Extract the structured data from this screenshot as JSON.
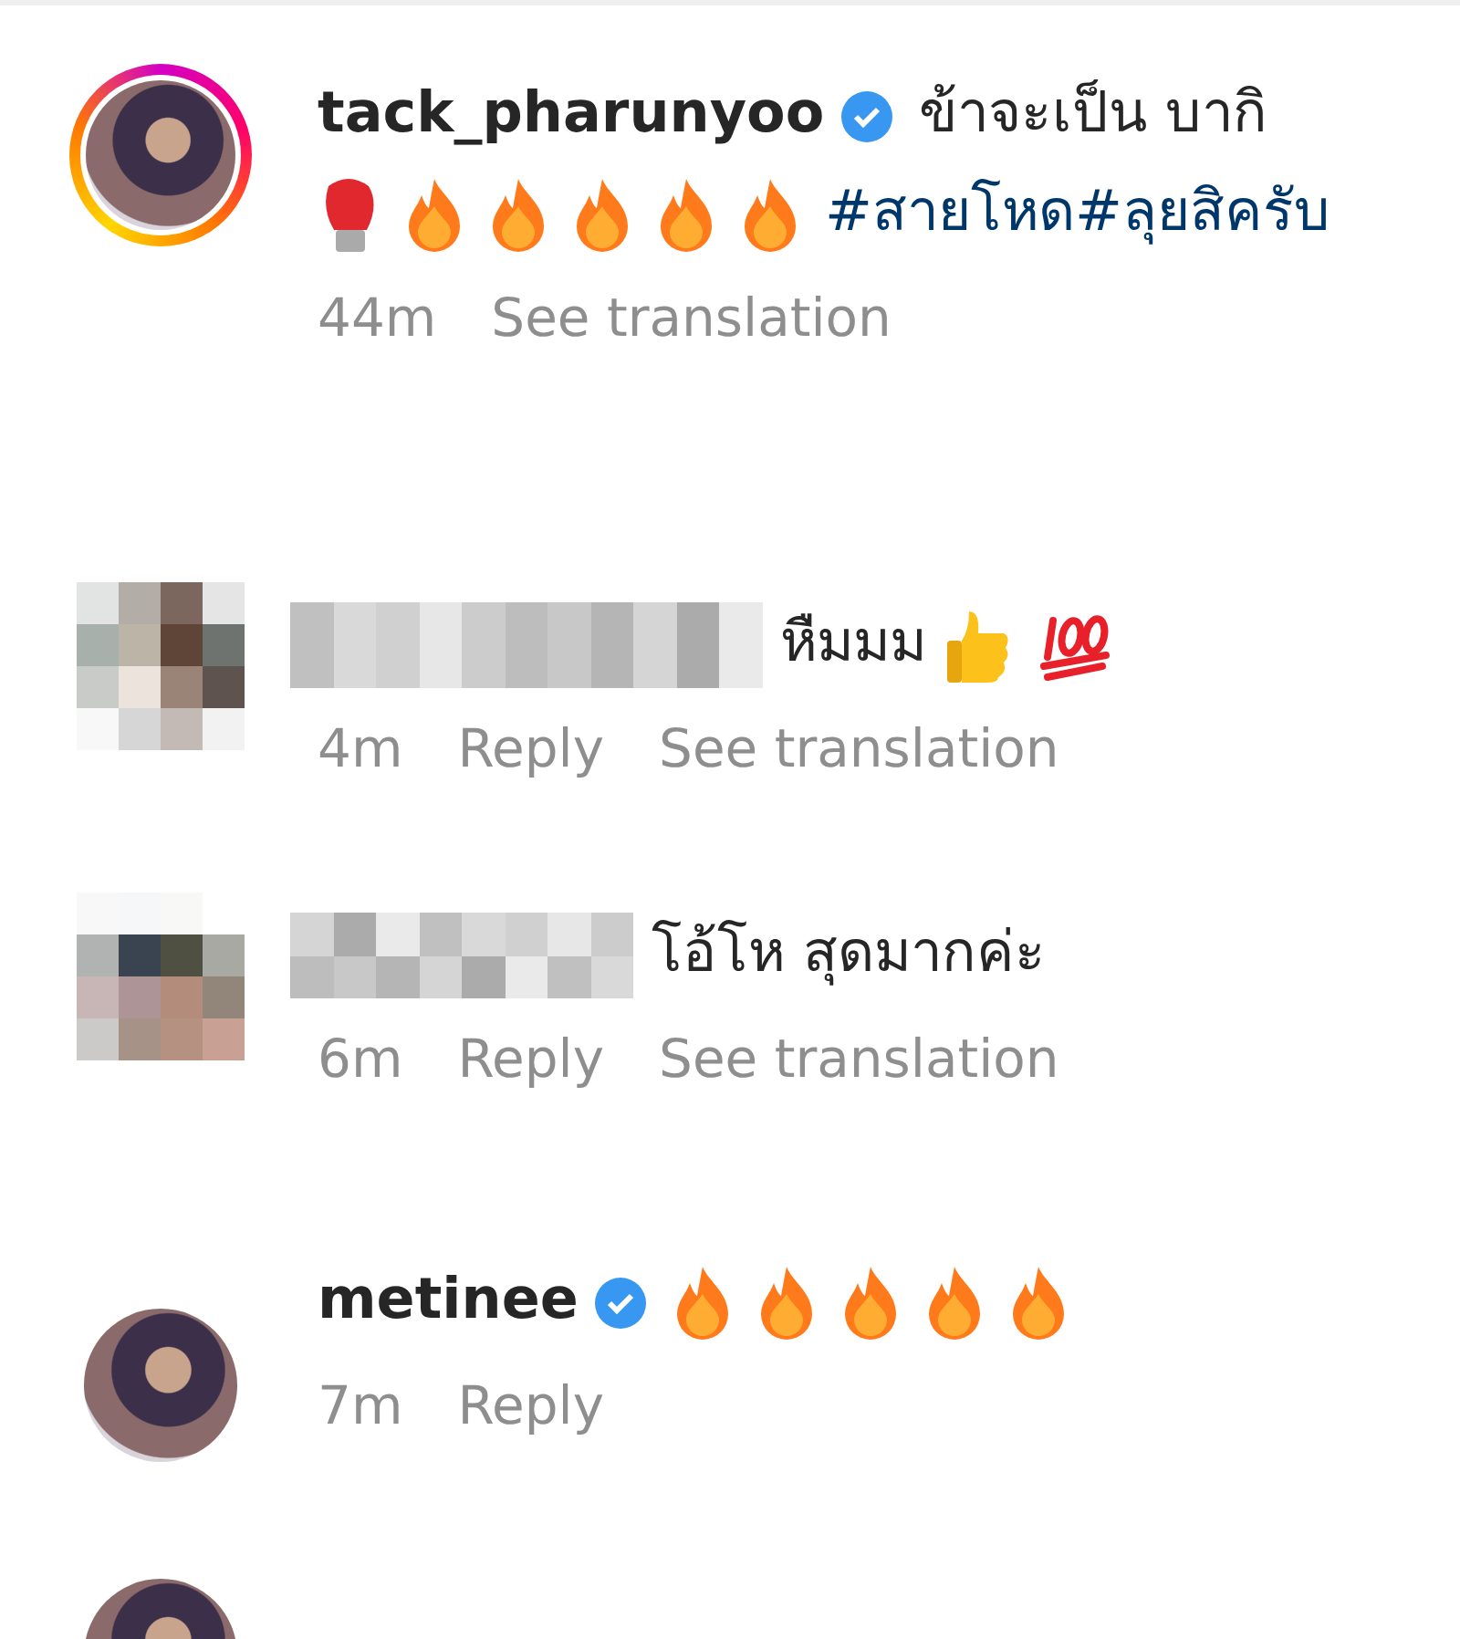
{
  "comments": [
    {
      "avatar": {
        "kind": "ring-photo"
      },
      "username": "tack_pharunyoo",
      "verified": true,
      "name_blurred": false,
      "parts": [
        {
          "kind": "text",
          "text": "ข้าจะเป็น บากิ"
        },
        {
          "kind": "boxing-glove"
        },
        {
          "kind": "fire"
        },
        {
          "kind": "fire"
        },
        {
          "kind": "fire"
        },
        {
          "kind": "fire"
        },
        {
          "kind": "fire"
        },
        {
          "kind": "hashtag",
          "text": "#สายโหด#ลุยสิครับ"
        }
      ],
      "time": "44m",
      "actions": [
        "See translation"
      ]
    },
    {
      "avatar": {
        "kind": "pixelated"
      },
      "verified": false,
      "name_blurred": true,
      "parts": [
        {
          "kind": "text",
          "text": "หืมมม"
        },
        {
          "kind": "thumbs-up"
        },
        {
          "kind": "hundred"
        }
      ],
      "time": "4m",
      "actions": [
        "Reply",
        "See translation"
      ]
    },
    {
      "avatar": {
        "kind": "pixelated"
      },
      "verified": false,
      "name_blurred": true,
      "parts": [
        {
          "kind": "text",
          "text": "โอ้โห สุดมากค่ะ"
        }
      ],
      "time": "6m",
      "actions": [
        "Reply",
        "See translation"
      ]
    },
    {
      "avatar": {
        "kind": "photo"
      },
      "username": "metinee",
      "verified": true,
      "name_blurred": false,
      "parts": [
        {
          "kind": "fire"
        },
        {
          "kind": "fire"
        },
        {
          "kind": "fire"
        },
        {
          "kind": "fire"
        },
        {
          "kind": "fire"
        }
      ],
      "time": "7m",
      "actions": [
        "Reply"
      ]
    },
    {
      "avatar": {
        "kind": "photo"
      }
    }
  ]
}
